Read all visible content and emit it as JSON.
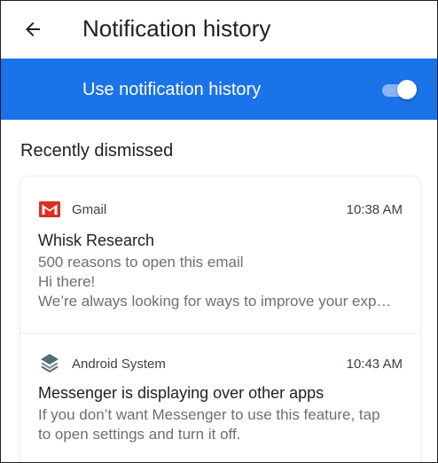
{
  "header": {
    "title": "Notification history",
    "back_icon": "arrow-back-icon"
  },
  "master_switch": {
    "label": "Use notification history",
    "state": "on",
    "bar_color": "#1a73e8"
  },
  "recently_dismissed": {
    "heading": "Recently dismissed",
    "items": [
      {
        "app": "Gmail",
        "icon": "gmail-icon",
        "time": "10:38 AM",
        "title": "Whisk Research",
        "lines": [
          "500 reasons to open this email",
          "Hi there!",
          "We’re always looking for ways to improve your exp…"
        ]
      },
      {
        "app": "Android System",
        "icon": "android-system-icon",
        "time": "10:43 AM",
        "title": "Messenger is displaying over other apps",
        "lines": [
          "If you don’t want Messenger to use this feature, tap",
          "to open settings and turn it off."
        ]
      }
    ]
  },
  "colors": {
    "accent": "#1a73e8",
    "gmail_red": "#d93025",
    "android_system_icon": "#546e7a"
  }
}
